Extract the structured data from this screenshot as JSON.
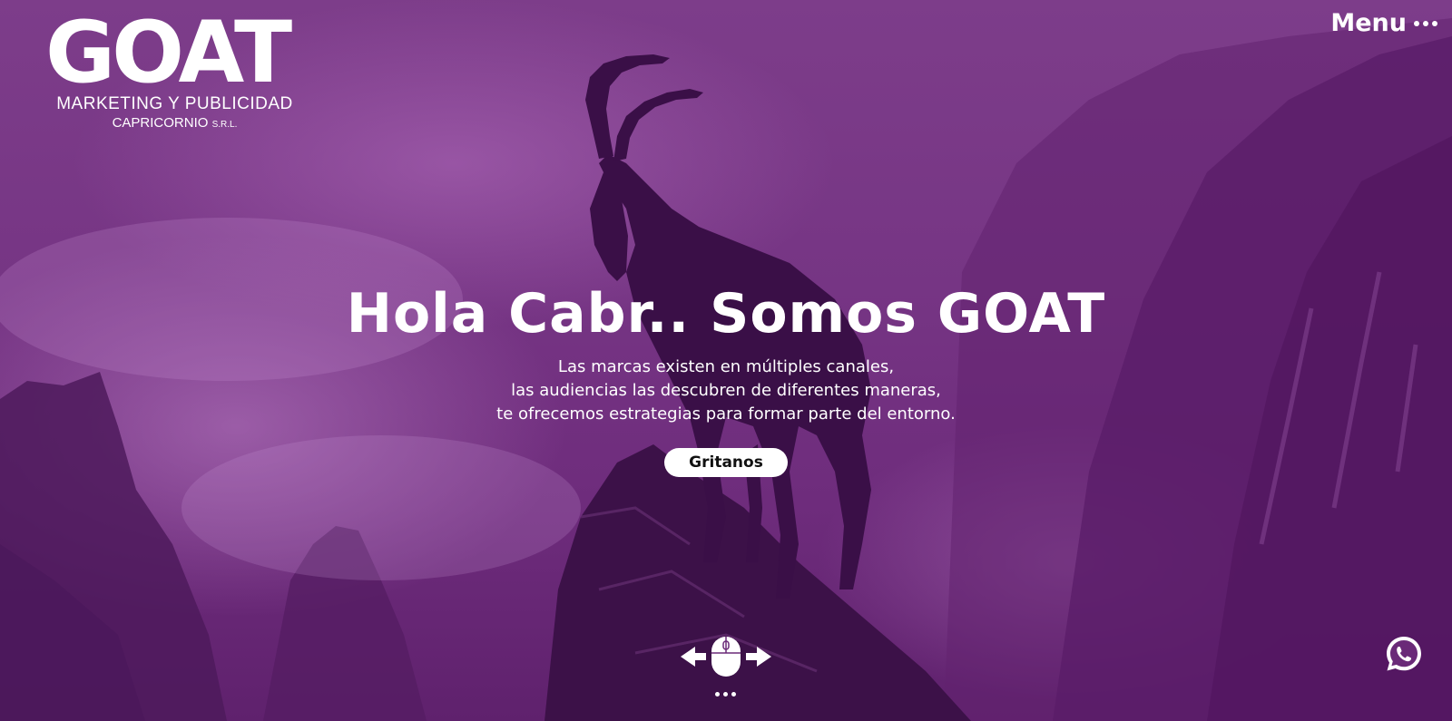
{
  "brand": {
    "logo_text": "GOAT",
    "tagline_line1": "MARKETING Y PUBLICIDAD",
    "tagline_line2": "CAPRICORNIO",
    "tagline_suffix": "S.R.L."
  },
  "nav": {
    "menu_label": "Menu"
  },
  "hero": {
    "title": "Hola Cabr.. Somos GOAT",
    "lines": [
      "Las marcas existen en múltiples canales,",
      "las audiencias las descubren de diferentes maneras,",
      "te ofrecemos estrategias para formar parte del entorno."
    ],
    "cta_label": "Gritanos"
  },
  "icons": {
    "scroll": "mouse-scroll-arrows-icon",
    "chat": "whatsapp-icon"
  },
  "colors": {
    "overlay": "#6a2a78",
    "text": "#ffffff",
    "button_bg": "#ffffff",
    "button_text": "#111111",
    "whatsapp": "#ffffff"
  }
}
